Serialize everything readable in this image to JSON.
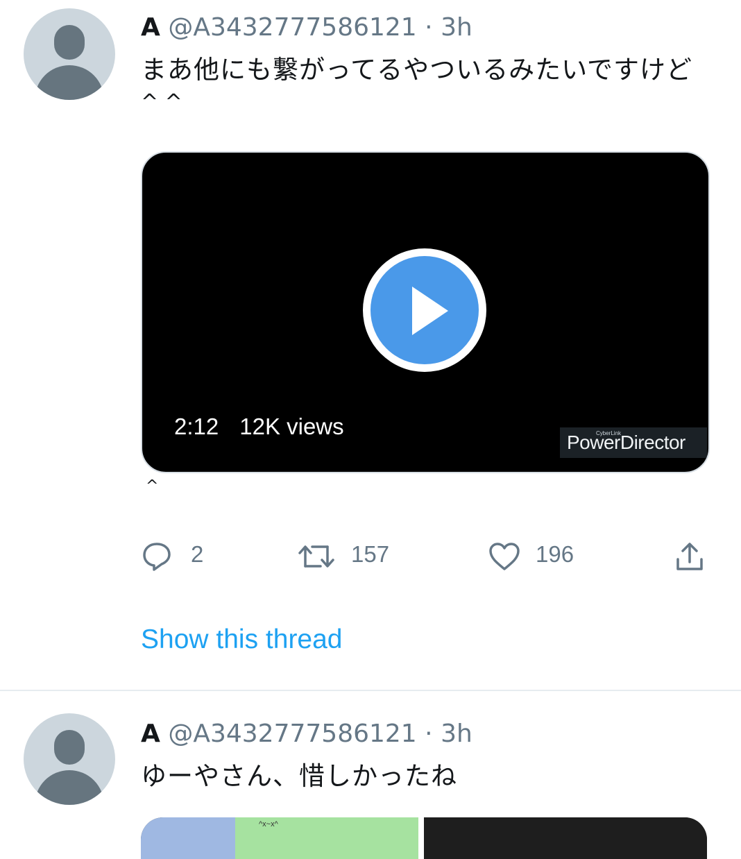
{
  "tweets": [
    {
      "author_name": "A",
      "author_handle": "@A3432777586121",
      "dot": "·",
      "time": "3h",
      "text": "まあ他にも繋がってるやついるみたいですけど",
      "cut_text": "^ ^",
      "video": {
        "duration": "2:12",
        "views": "12K views",
        "watermark_brand": "CyberLink",
        "watermark_product": "PowerDirector"
      },
      "caret": "^",
      "actions": {
        "reply_count": "2",
        "retweet_count": "157",
        "like_count": "196"
      },
      "show_thread": "Show this thread"
    },
    {
      "author_name": "A",
      "author_handle": "@A3432777586121",
      "dot": "·",
      "time": "3h",
      "text": "ゆーやさん、惜しかったね",
      "preview_text": "^x~x^"
    }
  ],
  "colors": {
    "link": "#1da1f2",
    "secondary_text": "#657786",
    "play_button": "#4a99e9"
  },
  "icons": [
    "reply-icon",
    "retweet-icon",
    "like-icon",
    "share-icon",
    "play-icon"
  ]
}
